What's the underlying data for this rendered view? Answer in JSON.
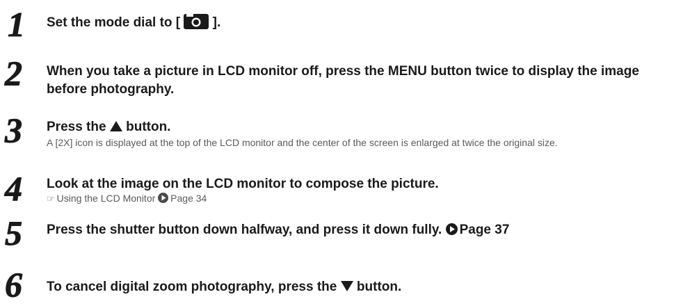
{
  "steps": [
    {
      "number": "1",
      "title_before": "Set the mode dial to [ ",
      "title_icon": "camera-icon",
      "title_after": " ]."
    },
    {
      "number": "2",
      "title": "When you take a picture in LCD monitor off, press the MENU button twice to display the image before photography."
    },
    {
      "number": "3",
      "title_before": "Press the ",
      "title_icon": "up-triangle-icon",
      "title_after": " button.",
      "detail": "A [2X] icon is displayed at the top of the LCD monitor and the center of the screen is enlarged at twice the original size."
    },
    {
      "number": "4",
      "title": "Look at the image on the LCD monitor to compose the picture.",
      "ref_icon": "manual-reference-icon",
      "ref_text": "Using the LCD Monitor",
      "ref_page_icon": "page-arrow-icon",
      "ref_page": "Page 34"
    },
    {
      "number": "5",
      "title": "Press the shutter button down halfway, and press it down fully.",
      "ref_page_icon": "page-arrow-icon",
      "ref_page": "Page 37"
    },
    {
      "number": "6",
      "title_before": "To cancel digital zoom photography, press the ",
      "title_icon": "down-triangle-icon",
      "title_after": " button."
    }
  ],
  "colors": {
    "title_text": "#1a1a1a",
    "detail_text": "#5a5a5a",
    "numeral_fill": "#1a1a1a"
  }
}
